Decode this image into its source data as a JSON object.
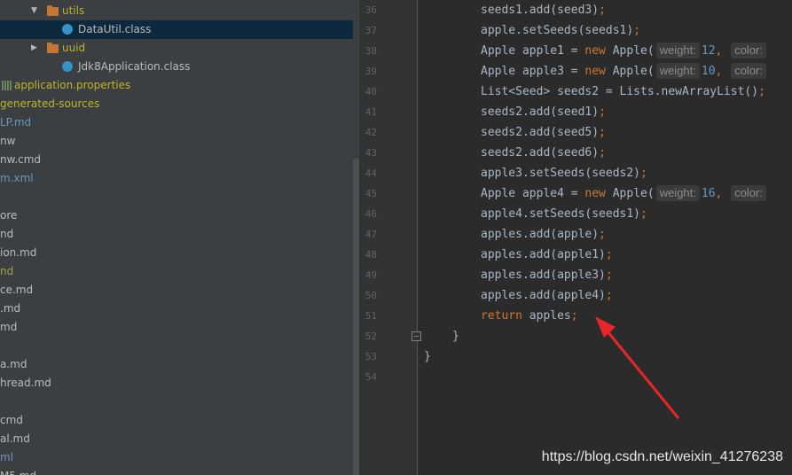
{
  "project_tree": {
    "rows": [
      {
        "label": "utils",
        "kind": "folder",
        "arrow": "▼",
        "color": "c-yellow"
      },
      {
        "label": "DataUtil.class",
        "kind": "class",
        "color": "c-gray",
        "selected": true
      },
      {
        "label": "uuid",
        "kind": "folder",
        "arrow": "▶",
        "color": "c-yellow"
      },
      {
        "label": "Jdk8Application.class",
        "kind": "class",
        "color": "c-gray"
      },
      {
        "label": "application.properties",
        "kind": "props",
        "color": "c-yellow"
      },
      {
        "label": "generated-sources",
        "kind": "text",
        "color": "c-yellow"
      },
      {
        "label": "LP.md",
        "kind": "text",
        "color": "c-blue"
      },
      {
        "label": "nw",
        "kind": "text",
        "color": "c-gray"
      },
      {
        "label": "nw.cmd",
        "kind": "text",
        "color": "c-gray"
      },
      {
        "label": "m.xml",
        "kind": "text",
        "color": "c-blue"
      },
      {
        "label": "",
        "kind": "blank",
        "color": "c-gray"
      },
      {
        "label": "ore",
        "kind": "text",
        "color": "c-gray"
      },
      {
        "label": "nd",
        "kind": "text",
        "color": "c-gray"
      },
      {
        "label": "ion.md",
        "kind": "text",
        "color": "c-gray"
      },
      {
        "label": "nd",
        "kind": "text",
        "color": "c-olive"
      },
      {
        "label": "ce.md",
        "kind": "text",
        "color": "c-gray"
      },
      {
        "label": ".md",
        "kind": "text",
        "color": "c-gray"
      },
      {
        "label": "md",
        "kind": "text",
        "color": "c-gray"
      },
      {
        "label": "",
        "kind": "blank",
        "color": "c-gray"
      },
      {
        "label": "a.md",
        "kind": "text",
        "color": "c-gray"
      },
      {
        "label": "hread.md",
        "kind": "text",
        "color": "c-gray"
      },
      {
        "label": "",
        "kind": "blank",
        "color": "c-gray"
      },
      {
        "label": "cmd",
        "kind": "text",
        "color": "c-gray"
      },
      {
        "label": "al.md",
        "kind": "text",
        "color": "c-gray"
      },
      {
        "label": "ml",
        "kind": "text",
        "color": "c-blue"
      },
      {
        "label": "M5.md",
        "kind": "text",
        "color": "c-gray"
      }
    ]
  },
  "editor": {
    "line_numbers": [
      "36",
      "37",
      "38",
      "39",
      "40",
      "41",
      "42",
      "43",
      "44",
      "45",
      "46",
      "47",
      "48",
      "49",
      "50",
      "51",
      "52",
      "53",
      "54"
    ],
    "lines": [
      [
        {
          "t": "seeds1.add(seed3)",
          "c": ""
        },
        {
          "t": ";",
          "c": "kw"
        }
      ],
      [
        {
          "t": "apple.setSeeds(seeds1)",
          "c": ""
        },
        {
          "t": ";",
          "c": "kw"
        }
      ],
      [
        {
          "t": "Apple apple1 = ",
          "c": ""
        },
        {
          "t": "new ",
          "c": "kw"
        },
        {
          "t": "Apple(",
          "c": ""
        },
        {
          "t": "weight:",
          "c": "hint"
        },
        {
          "t": "12",
          "c": "num"
        },
        {
          "t": ", ",
          "c": "kw"
        },
        {
          "t": "color:",
          "c": "hint"
        }
      ],
      [
        {
          "t": "Apple apple3 = ",
          "c": ""
        },
        {
          "t": "new ",
          "c": "kw"
        },
        {
          "t": "Apple(",
          "c": ""
        },
        {
          "t": "weight:",
          "c": "hint"
        },
        {
          "t": "10",
          "c": "num"
        },
        {
          "t": ", ",
          "c": "kw"
        },
        {
          "t": "color:",
          "c": "hint"
        }
      ],
      [
        {
          "t": "List<Seed> seeds2 = Lists.newArrayList()",
          "c": ""
        },
        {
          "t": ";",
          "c": "kw"
        }
      ],
      [
        {
          "t": "seeds2.add(seed1)",
          "c": ""
        },
        {
          "t": ";",
          "c": "kw"
        }
      ],
      [
        {
          "t": "seeds2.add(seed5)",
          "c": ""
        },
        {
          "t": ";",
          "c": "kw"
        }
      ],
      [
        {
          "t": "seeds2.add(seed6)",
          "c": ""
        },
        {
          "t": ";",
          "c": "kw"
        }
      ],
      [
        {
          "t": "apple3.setSeeds(seeds2)",
          "c": ""
        },
        {
          "t": ";",
          "c": "kw"
        }
      ],
      [
        {
          "t": "Apple apple4 = ",
          "c": ""
        },
        {
          "t": "new ",
          "c": "kw"
        },
        {
          "t": "Apple(",
          "c": ""
        },
        {
          "t": "weight:",
          "c": "hint"
        },
        {
          "t": "16",
          "c": "num"
        },
        {
          "t": ", ",
          "c": "kw"
        },
        {
          "t": "color:",
          "c": "hint"
        }
      ],
      [
        {
          "t": "apple4.setSeeds(seeds1)",
          "c": ""
        },
        {
          "t": ";",
          "c": "kw"
        }
      ],
      [
        {
          "t": "apples.add(apple)",
          "c": ""
        },
        {
          "t": ";",
          "c": "kw"
        }
      ],
      [
        {
          "t": "apples.add(apple1)",
          "c": ""
        },
        {
          "t": ";",
          "c": "kw"
        }
      ],
      [
        {
          "t": "apples.add(apple3)",
          "c": ""
        },
        {
          "t": ";",
          "c": "kw"
        }
      ],
      [
        {
          "t": "apples.add(apple4)",
          "c": ""
        },
        {
          "t": ";",
          "c": "kw"
        }
      ],
      [
        {
          "t": "return ",
          "c": "kw"
        },
        {
          "t": "apples",
          "c": ""
        },
        {
          "t": ";",
          "c": "kw"
        }
      ],
      [
        {
          "t": "}",
          "c": ""
        }
      ],
      [
        {
          "t": "}",
          "c": ""
        }
      ],
      []
    ]
  },
  "watermark": "https://blog.csdn.net/weixin_41276238"
}
